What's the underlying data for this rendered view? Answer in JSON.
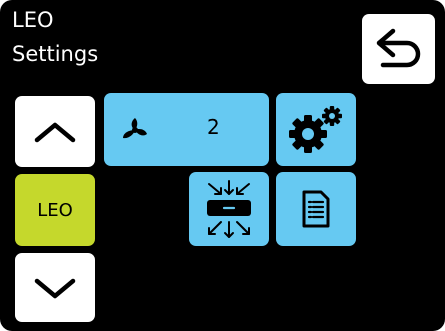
{
  "header": {
    "device_name": "LEO",
    "page_title": "Settings"
  },
  "controls": {
    "selected_device_label": "LEO",
    "fan_speed": "2"
  },
  "icons": {
    "back": "back-arrow-icon",
    "up": "chevron-up-icon",
    "down": "chevron-down-icon",
    "fan": "fan-icon",
    "settings": "gears-icon",
    "vent": "vent-arrows-icon",
    "document": "document-icon"
  },
  "colors": {
    "background": "#000000",
    "button_blue": "#66c9f2",
    "button_lime": "#c5d82c",
    "button_white": "#ffffff"
  }
}
